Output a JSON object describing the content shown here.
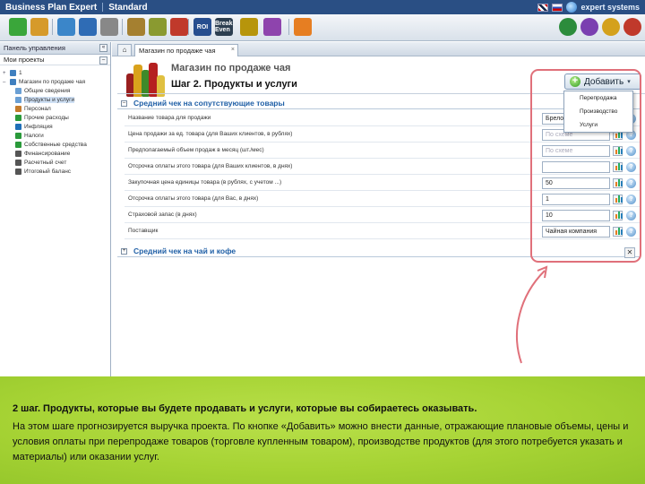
{
  "window": {
    "app_name": "Business Plan Expert",
    "edition": "Standard",
    "brand": "expert systems"
  },
  "toolbar": {
    "buttons": [
      {
        "name": "add-icon",
        "color": "#3aa63a",
        "text": ""
      },
      {
        "name": "open-icon",
        "color": "#d69a2a",
        "text": ""
      },
      {
        "name": "copy-icon",
        "color": "#3b86c9",
        "text": ""
      },
      {
        "name": "save-icon",
        "color": "#2f6cb5",
        "text": ""
      },
      {
        "name": "delete-icon",
        "color": "#888888",
        "text": ""
      },
      {
        "name": "balance-icon",
        "color": "#a58030",
        "text": ""
      },
      {
        "name": "money-bag-icon",
        "color": "#8a9a30",
        "text": ""
      },
      {
        "name": "arrow-down-icon",
        "color": "#c0392b",
        "text": ""
      },
      {
        "name": "roi-icon",
        "color": "#274e8f",
        "text": "ROI"
      },
      {
        "name": "break-even-icon",
        "color": "#2c3e50",
        "text": "Break Even"
      },
      {
        "name": "ratios-icon",
        "color": "#b7950b",
        "text": ""
      },
      {
        "name": "chart-icon",
        "color": "#8e44ad",
        "text": ""
      },
      {
        "name": "play-icon",
        "color": "#e67e22",
        "text": ""
      }
    ],
    "right_buttons": [
      {
        "name": "users-icon",
        "color": "#2c8c3c"
      },
      {
        "name": "help-icon",
        "color": "#7a3fb0"
      },
      {
        "name": "edit-icon",
        "color": "#d4a11c"
      },
      {
        "name": "lock-icon",
        "color": "#c0392b"
      }
    ]
  },
  "left_panel": {
    "title": "Панель управления",
    "collapse": "«",
    "subheader": "Мои проекты",
    "subheader_btn": "–",
    "tree": [
      {
        "level": 0,
        "toggle": "+",
        "label": "1",
        "icon": "#3f7fbf",
        "selected": false
      },
      {
        "level": 0,
        "toggle": "–",
        "label": "Магазин по продаже чая",
        "icon": "#3f7fbf",
        "selected": false
      },
      {
        "level": 1,
        "toggle": "",
        "label": "Общие сведения",
        "icon": "#6a9fd4",
        "selected": false
      },
      {
        "level": 1,
        "toggle": "",
        "label": "Продукты и услуги",
        "icon": "#6a9fd4",
        "selected": true
      },
      {
        "level": 1,
        "toggle": "",
        "label": "Персонал",
        "icon": "#c47b2c",
        "selected": false
      },
      {
        "level": 1,
        "toggle": "",
        "label": "Прочие расходы",
        "icon": "#2a9a3a",
        "selected": false
      },
      {
        "level": 1,
        "toggle": "",
        "label": "Инфляция",
        "icon": "#1f6fb8",
        "selected": false
      },
      {
        "level": 1,
        "toggle": "",
        "label": "Налоги",
        "icon": "#2a9a3a",
        "selected": false
      },
      {
        "level": 1,
        "toggle": "",
        "label": "Собственные средства",
        "icon": "#2a9a3a",
        "selected": false
      },
      {
        "level": 1,
        "toggle": "",
        "label": "Финансирование",
        "icon": "#555555",
        "selected": false
      },
      {
        "level": 1,
        "toggle": "",
        "label": "Расчетный счет",
        "icon": "#555555",
        "selected": false
      },
      {
        "level": 1,
        "toggle": "",
        "label": "Итоговый баланс",
        "icon": "#555555",
        "selected": false
      }
    ]
  },
  "tabs": {
    "home": "⌂",
    "document": "Магазин по продаже чая",
    "close": "×"
  },
  "page": {
    "heading1": "Магазин по продаже чая",
    "heading2": "Шаг 2. Продукты и услуги"
  },
  "add_button": {
    "label": "Добавить",
    "plus": "+",
    "arrow": "▾"
  },
  "dropdown": {
    "items": [
      "Перепродажа",
      "Производство",
      "Услуги"
    ]
  },
  "sections": [
    {
      "toggle": "–",
      "title": "Средний чек на сопутствующие товары"
    },
    {
      "toggle": "+",
      "title": "Средний чек на чай и кофе"
    }
  ],
  "form_rows": [
    {
      "label": "Название товара для продажи",
      "value": "Брелоки",
      "placeholder": false,
      "chart": false,
      "help": "?"
    },
    {
      "label": "Цена продажи за ед. товара (для Ваших клиентов, в рублях)",
      "value": "По схеме",
      "placeholder": true,
      "chart": true,
      "help": "?"
    },
    {
      "label": "Предполагаемый объем продаж в месяц (шт./мес)",
      "value": "По схеме",
      "placeholder": true,
      "chart": true,
      "help": "?"
    },
    {
      "label": "Отсрочка оплаты этого товара (для Ваших клиентов, в днях)",
      "value": "",
      "placeholder": false,
      "chart": true,
      "help": "?"
    },
    {
      "label": "Закупочная цена единицы товара (в рублях, с учетом ...)",
      "value": "50",
      "placeholder": false,
      "chart": true,
      "help": "?"
    },
    {
      "label": "Отсрочка оплаты этого товара (для Вас, в днях)",
      "value": "1",
      "placeholder": false,
      "chart": true,
      "help": "?"
    },
    {
      "label": "Страховой запас (в днях)",
      "value": "10",
      "placeholder": false,
      "chart": true,
      "help": "?"
    },
    {
      "label": "Поставщик",
      "value": "Чайная компания",
      "placeholder": false,
      "chart": true,
      "help": "?"
    }
  ],
  "delete_icon": "✕",
  "annotation": {
    "title": "2 шаг. Продукты, которые вы будете продавать и услуги, которые вы собираетесь оказывать.",
    "text": "На этом шаге прогнозируется выручка проекта. По кнопке «Добавить» можно внести данные, отражающие плановые объемы, цены и условия оплаты при перепродаже товаров (торговле купленным товаром), производстве продуктов (для этого потребуется указать и материалы) или оказании услуг."
  },
  "colors": {
    "accent": "#1f5fa6",
    "highlight": "#e0707a",
    "band": "#a6d334"
  }
}
